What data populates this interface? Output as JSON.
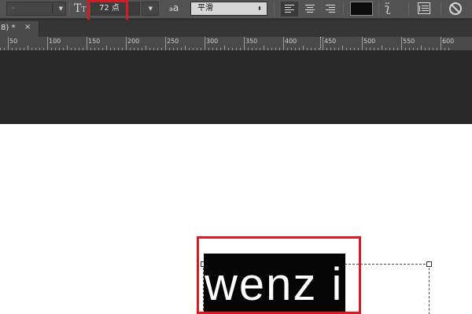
{
  "options_bar": {
    "font_style_value": "-",
    "font_size_value": "72 点",
    "antialias_icon_text": "a",
    "antialias_icon_text_big": "a",
    "antialias_value": "平滑",
    "text_color": "#0d0d0d",
    "accent_highlight": "#d51c24",
    "icons": [
      "size-icon",
      "antialias-icon",
      "align-left-icon",
      "align-center-icon",
      "align-right-icon",
      "warp-text-icon",
      "panel-toggle-icon",
      "cancel-icon"
    ]
  },
  "document_tab": {
    "label": "8) *",
    "close": "×"
  },
  "ruler": {
    "labels": [
      "50",
      "100",
      "150",
      "200",
      "250",
      "300",
      "350",
      "400",
      "450",
      "500",
      "550",
      "600"
    ]
  },
  "canvas": {
    "text": "wenz i"
  }
}
